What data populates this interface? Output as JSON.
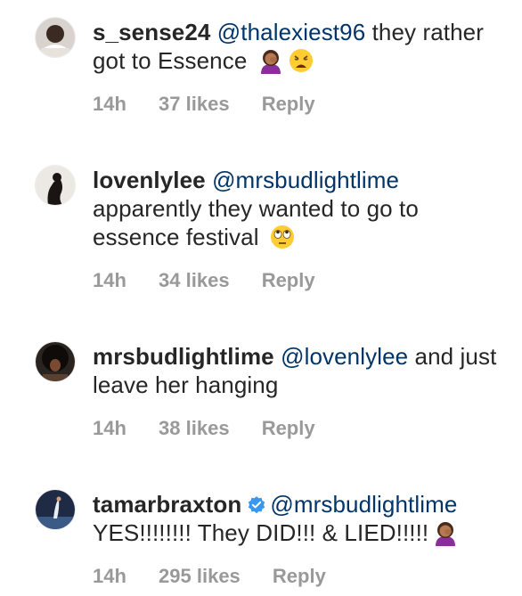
{
  "comments": [
    {
      "username": "s_sense24",
      "mention": "@thalexiest96",
      "text": " they rather got to Essence",
      "emojis": [
        "woman-facepalming-icon",
        "weary-face-icon"
      ],
      "time": "14h",
      "likes": "37 likes",
      "reply": "Reply",
      "verified": false
    },
    {
      "username": "lovenlylee",
      "mention": "@mrsbudlightlime",
      "text": " apparently they wanted to go to essence festival",
      "emojis": [
        "eye-roll-face-icon"
      ],
      "time": "14h",
      "likes": "34 likes",
      "reply": "Reply",
      "verified": false
    },
    {
      "username": "mrsbudlightlime",
      "mention": "@lovenlylee",
      "text": " and just leave her hanging",
      "emojis": [],
      "time": "14h",
      "likes": "38 likes",
      "reply": "Reply",
      "verified": false
    },
    {
      "username": "tamarbraxton",
      "mention": "@mrsbudlightlime",
      "text": " YES!!!!!!!! They DID!!! & LIED!!!!!",
      "emojis": [
        "woman-facepalming-icon"
      ],
      "time": "14h",
      "likes": "295 likes",
      "reply": "Reply",
      "verified": true
    }
  ],
  "colors": {
    "username": "#262626",
    "mention": "#003569",
    "meta": "#999999",
    "verified": "#3897f0"
  }
}
